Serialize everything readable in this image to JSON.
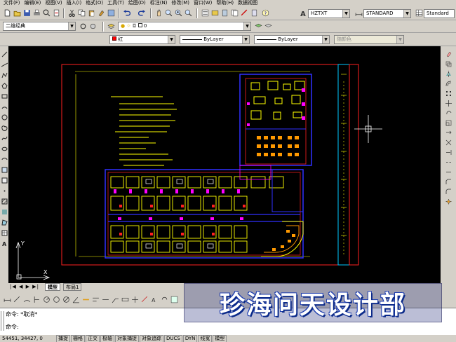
{
  "menu": {
    "items": [
      "文件(F)",
      "编辑(E)",
      "视图(V)",
      "插入(I)",
      "格式(O)",
      "工具(T)",
      "绘图(D)",
      "标注(N)",
      "修改(M)",
      "窗口(W)",
      "帮助(H)",
      "数据视图"
    ]
  },
  "toolbar": {
    "text_style": "HZTXT",
    "dim_style": "STANDARD",
    "table_style": "Standard",
    "workspace": "二维经典",
    "layer": "0",
    "color": "红",
    "linetype": "ByLayer",
    "lineweight": "ByLayer",
    "plotstyle": "随颜色"
  },
  "tabs": {
    "model": "模型",
    "layout1": "布局1"
  },
  "command": {
    "line1": "命令: *取消*",
    "line2": "命令:"
  },
  "status": {
    "coords": "54451, 34427, 0",
    "buttons": [
      "捕捉",
      "栅格",
      "正交",
      "极轴",
      "对象捕捉",
      "对象追踪",
      "DUCS",
      "DYN",
      "线宽",
      "模型"
    ]
  },
  "ucs": {
    "x": "X",
    "y": "Y"
  },
  "watermark": "珍海问天设计部",
  "colors": {
    "canvas": "#000000",
    "frame": "#ff2020",
    "walls": "#ffff00",
    "blue": "#3030ff",
    "magenta": "#ff00ff",
    "cyan": "#00c8ff"
  }
}
